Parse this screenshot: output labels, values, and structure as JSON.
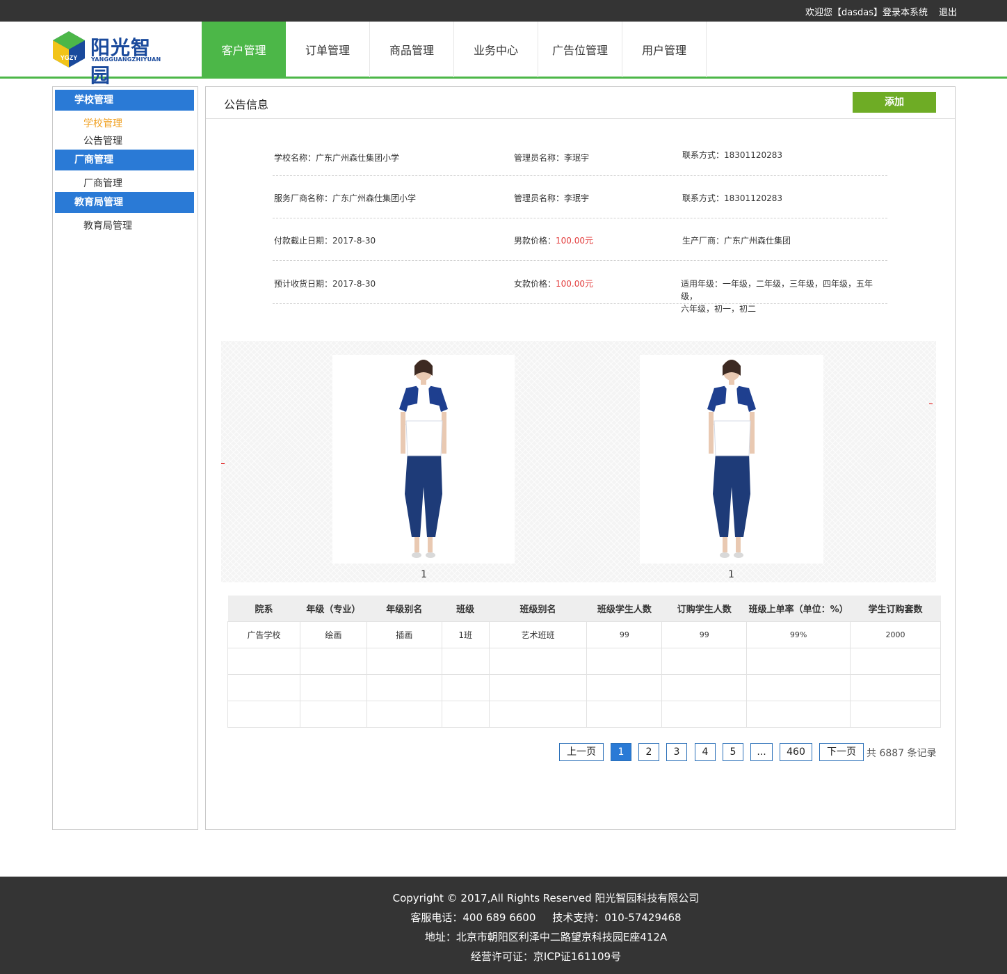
{
  "topbar": {
    "welcome": "欢迎您【dasdas】登录本系统",
    "logout": "退出"
  },
  "logo": {
    "mark_text": "YGZY",
    "brand": "阳光智园",
    "brand_en": "YANGGUANGZHIYUAN",
    "colors": {
      "green": "#4cb748",
      "yellow": "#f2c418",
      "blue": "#1a4a9c"
    }
  },
  "nav": {
    "tabs": [
      "客户管理",
      "订单管理",
      "商品管理",
      "业务中心",
      "广告位管理",
      "用户管理"
    ],
    "active": 0,
    "accent": "#4cb748"
  },
  "sidebar": {
    "groups": [
      {
        "title": "学校管理",
        "items": [
          "学校管理",
          "公告管理"
        ]
      },
      {
        "title": "厂商管理",
        "items": [
          "厂商管理"
        ]
      },
      {
        "title": "教育局管理",
        "items": [
          "教育局管理"
        ]
      }
    ],
    "active_item": "学校管理"
  },
  "main": {
    "title": "公告信息",
    "add_label": "添加",
    "info": {
      "school_name": {
        "label": "学校名称：",
        "value": "广东广州森仕集团小学"
      },
      "admin1": {
        "label": "管理员名称：",
        "value": "李珉宇"
      },
      "contact1": {
        "label": "联系方式：",
        "value": "18301120283"
      },
      "vendor_name": {
        "label": "服务厂商名称：",
        "value": "广东广州森仕集团小学"
      },
      "admin2": {
        "label": "管理员名称：",
        "value": "李珉宇"
      },
      "contact2": {
        "label": "联系方式：",
        "value": "18301120283"
      },
      "pay_deadline": {
        "label": "付款截止日期：",
        "value": "2017-8-30"
      },
      "male_price": {
        "label": "男款价格：",
        "value": "100.00元"
      },
      "manufacturer": {
        "label": "生产厂商：",
        "value": "广东广州森仕集团"
      },
      "delivery_date": {
        "label": "预计收货日期：",
        "value": "2017-8-30"
      },
      "female_price": {
        "label": "女款价格：",
        "value": "100.00元"
      },
      "grades": {
        "label": "适用年级：",
        "value": "一年级，二年级，三年级，四年级，五年级，",
        "value2": "六年级，初一，初二"
      }
    },
    "photos": [
      {
        "caption": "1"
      },
      {
        "caption": "1"
      }
    ],
    "table": {
      "headers": [
        "院系",
        "年级（专业）",
        "年级别名",
        "班级",
        "班级别名",
        "班级学生人数",
        "订购学生人数",
        "班级上单率（单位：%）",
        "学生订购套数"
      ],
      "rows": [
        [
          "广告学校",
          "绘画",
          "插画",
          "1班",
          "艺术班班",
          "99",
          "99",
          "99%",
          "2000"
        ],
        [
          "",
          "",
          "",
          "",
          "",
          "",
          "",
          "",
          ""
        ],
        [
          "",
          "",
          "",
          "",
          "",
          "",
          "",
          "",
          ""
        ],
        [
          "",
          "",
          "",
          "",
          "",
          "",
          "",
          "",
          ""
        ]
      ]
    },
    "pager": {
      "prev": "上一页",
      "pages": [
        "1",
        "2",
        "3",
        "4",
        "5",
        "...",
        "460"
      ],
      "current": "1",
      "next": "下一页",
      "total": "共 6887 条记录"
    }
  },
  "footer": {
    "copyright": "Copyright © 2017,All Rights Reserved 阳光智园科技有限公司",
    "phones": "客服电话：400 689 6600     技术支持：010-57429468",
    "address": "地址：北京市朝阳区利泽中二路望京科技园E座412A",
    "license": "经营许可证：京ICP证161109号"
  }
}
